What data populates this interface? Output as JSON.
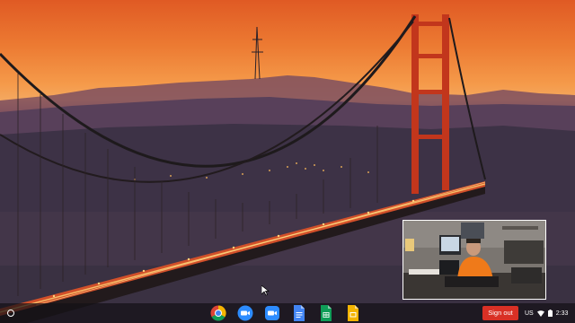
{
  "shelf": {
    "apps": [
      {
        "name": "Google Chrome",
        "icon": "chrome-icon"
      },
      {
        "name": "Zoom",
        "icon": "zoom-icon"
      },
      {
        "name": "Zoom",
        "icon": "zoom-icon"
      },
      {
        "name": "Google Docs",
        "icon": "docs-icon"
      },
      {
        "name": "Google Sheets",
        "icon": "sheets-icon"
      },
      {
        "name": "Google Slides",
        "icon": "slides-icon"
      }
    ],
    "sign_out_label": "Sign out",
    "keyboard_layout": "US",
    "time": "2:33"
  },
  "colors": {
    "sign_out": "#d93025",
    "bridge": "#c2361c",
    "sky_top": "#e05a24",
    "sky_horizon": "#f4a860"
  },
  "video_overlay": {
    "description_icon": "video-feed"
  }
}
